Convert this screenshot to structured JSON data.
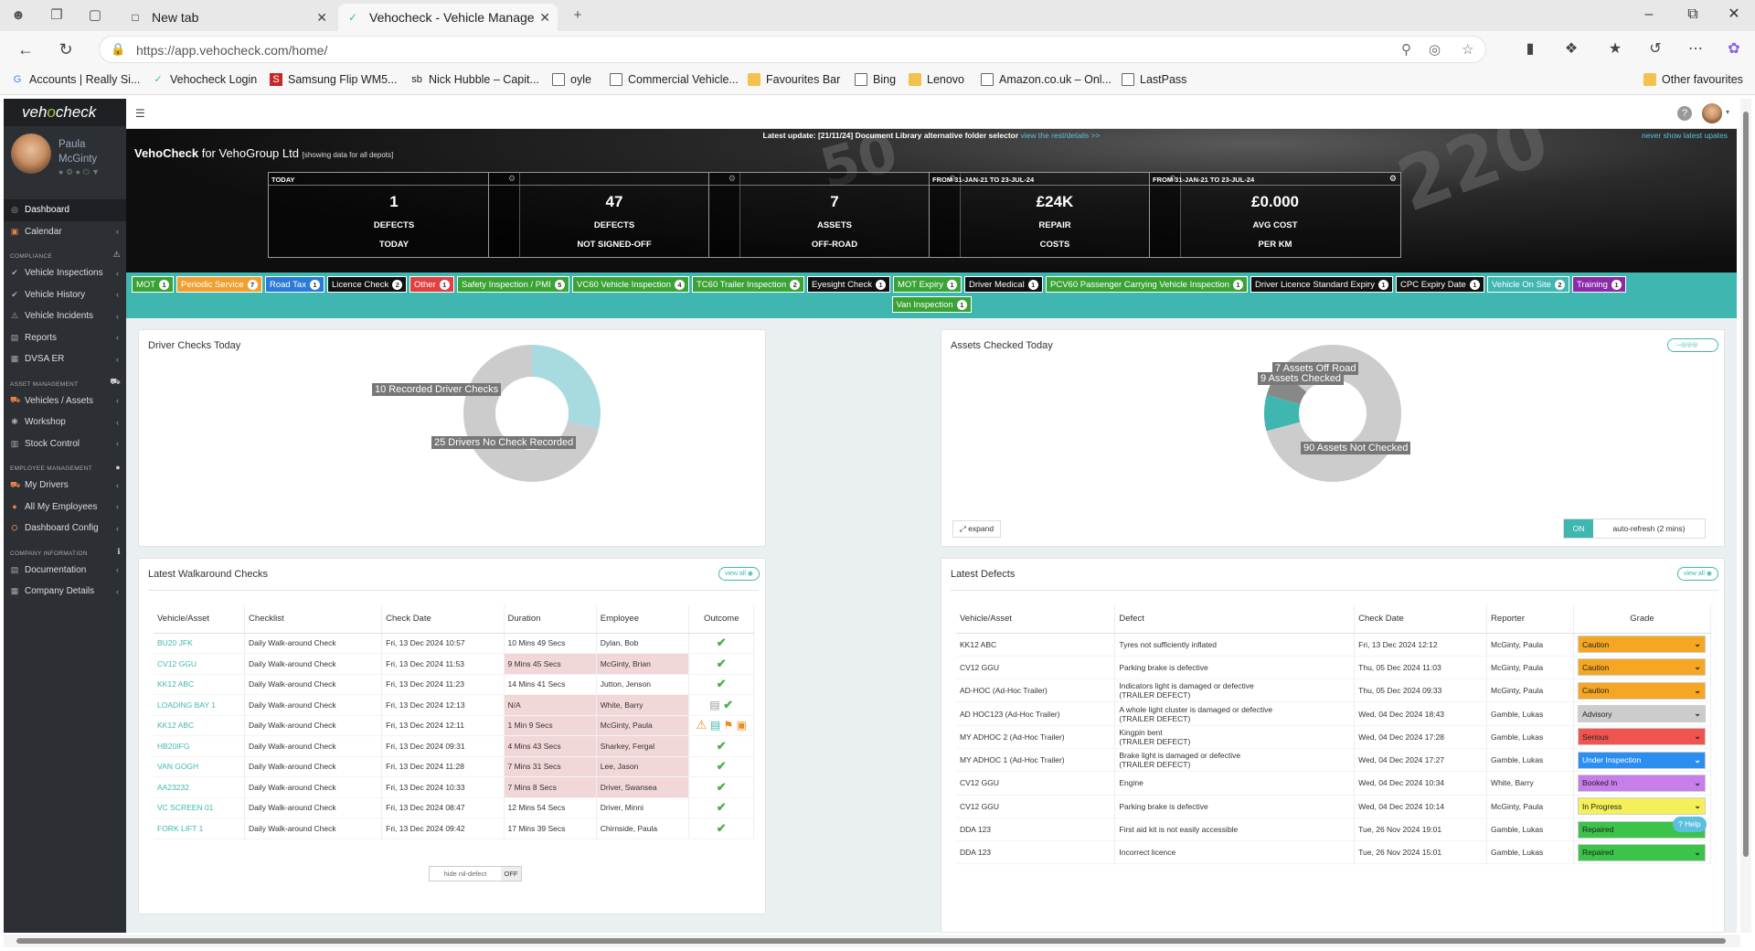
{
  "browser": {
    "tabs": [
      {
        "title": "New tab",
        "active": false
      },
      {
        "title": "Vehocheck - Vehicle Managemen",
        "active": true
      }
    ],
    "url": "https://app.vehocheck.com/home/",
    "bookmarks": [
      {
        "label": "Accounts | Really Si...",
        "icon": "google-icon"
      },
      {
        "label": "Vehocheck Login",
        "icon": "vehocheck-icon"
      },
      {
        "label": "Samsung Flip WM5...",
        "icon": "samsung-icon"
      },
      {
        "label": "Nick Hubble – Capit...",
        "icon": "sb-icon"
      },
      {
        "label": "oyle",
        "icon": "page-icon"
      },
      {
        "label": "Commercial Vehicle...",
        "icon": "page-icon"
      },
      {
        "label": "Favourites Bar",
        "icon": "folder-icon"
      },
      {
        "label": "Bing",
        "icon": "page-icon"
      },
      {
        "label": "Lenovo",
        "icon": "folder-icon"
      },
      {
        "label": "Amazon.co.uk – Onl...",
        "icon": "page-icon"
      },
      {
        "label": "LastPass",
        "icon": "page-icon"
      }
    ],
    "other_favourites": "Other favourites"
  },
  "sidebar": {
    "logo": "vehocheck",
    "user": {
      "first": "Paula",
      "last": "McGinty"
    },
    "items": [
      {
        "type": "item",
        "label": "Dashboard",
        "icon": "dashboard-icon",
        "active": true,
        "arrow": false
      },
      {
        "type": "item",
        "label": "Calendar",
        "icon": "calendar-icon",
        "arrow": true
      },
      {
        "type": "head",
        "label": "COMPLIANCE",
        "icon": "warning-icon"
      },
      {
        "type": "item",
        "label": "Vehicle Inspections",
        "icon": "check-icon",
        "arrow": true
      },
      {
        "type": "item",
        "label": "Vehicle History",
        "icon": "check-icon",
        "arrow": true
      },
      {
        "type": "item",
        "label": "Vehicle Incidents",
        "icon": "warning-icon",
        "arrow": true
      },
      {
        "type": "item",
        "label": "Reports",
        "icon": "report-icon",
        "arrow": true
      },
      {
        "type": "item",
        "label": "DVSA ER",
        "icon": "dvsa-icon",
        "arrow": true
      },
      {
        "type": "head",
        "label": "ASSET MANAGEMENT",
        "icon": "truck-icon"
      },
      {
        "type": "item",
        "label": "Vehicles / Assets",
        "icon": "truck-icon",
        "arrow": true
      },
      {
        "type": "item",
        "label": "Workshop",
        "icon": "wrench-icon",
        "arrow": true
      },
      {
        "type": "item",
        "label": "Stock Control",
        "icon": "box-icon",
        "arrow": true
      },
      {
        "type": "head",
        "label": "EMPLOYEE MANAGEMENT",
        "icon": "users-icon"
      },
      {
        "type": "item",
        "label": "My Drivers",
        "icon": "driver-icon",
        "arrow": true
      },
      {
        "type": "item",
        "label": "All My Employees",
        "icon": "users-icon",
        "arrow": true
      },
      {
        "type": "item",
        "label": "Dashboard Config",
        "icon": "config-icon",
        "arrow": true
      },
      {
        "type": "head",
        "label": "COMPANY INFORMATION",
        "icon": "info-icon"
      },
      {
        "type": "item",
        "label": "Documentation",
        "icon": "doc-icon",
        "arrow": true
      },
      {
        "type": "item",
        "label": "Company Details",
        "icon": "building-icon",
        "arrow": true
      }
    ]
  },
  "hero": {
    "update_label": "Latest update: [21/11/24] Document Library alternative folder selector",
    "update_link": "view the rest/details >>",
    "never_show": "never show latest upates",
    "company_prefix": "VehoCheck",
    "company_for": "for VehoGroup Ltd",
    "company_sub": "[showing data for all depots]",
    "stats": [
      {
        "header": "TODAY",
        "value": "1",
        "line1": "DEFECTS",
        "line2": "TODAY"
      },
      {
        "header": "",
        "value": "47",
        "line1": "DEFECTS",
        "line2": "NOT SIGNED-OFF"
      },
      {
        "header": "",
        "value": "7",
        "line1": "ASSETS",
        "line2": "OFF-ROAD"
      },
      {
        "header": "FROM 31-JAN-21 TO 23-JUL-24",
        "value": "£24K",
        "line1": "REPAIR",
        "line2": "COSTS"
      },
      {
        "header": "FROM 31-JAN-21 TO 23-JUL-24",
        "value": "£0.000",
        "line1": "AVG COST",
        "line2": "PER KM"
      }
    ]
  },
  "tags": [
    {
      "label": "MOT",
      "count": "1",
      "color": "#3aa335"
    },
    {
      "label": "Periodic Service",
      "count": "7",
      "color": "#f0a030"
    },
    {
      "label": "Road Tax",
      "count": "1",
      "color": "#2a7ad8"
    },
    {
      "label": "Licence Check",
      "count": "2",
      "color": "#111111"
    },
    {
      "label": "Other",
      "count": "1",
      "color": "#e04040"
    },
    {
      "label": "Safety Inspection / PMI",
      "count": "5",
      "color": "#3aa335"
    },
    {
      "label": "VC60 Vehicle Inspection",
      "count": "4",
      "color": "#3aa335"
    },
    {
      "label": "TC60 Trailer Inspection",
      "count": "2",
      "color": "#3aa335"
    },
    {
      "label": "Eyesight Check",
      "count": "1",
      "color": "#111111"
    },
    {
      "label": "MOT Expiry",
      "count": "1",
      "color": "#3aa335"
    },
    {
      "label": "Driver Medical",
      "count": "1",
      "color": "#111111"
    },
    {
      "label": "PCV60 Passenger Carrying Vehicle Inspection",
      "count": "1",
      "color": "#3aa335"
    },
    {
      "label": "Driver Licence Standard Expiry",
      "count": "1",
      "color": "#111111"
    },
    {
      "label": "CPC Expiry Date",
      "count": "1",
      "color": "#111111"
    },
    {
      "label": "Vehicle On Site",
      "count": "2",
      "color": "#3fb6b0"
    },
    {
      "label": "Training",
      "count": "1",
      "color": "#8a2aa8"
    },
    {
      "label": "Van Inspection",
      "count": "1",
      "color": "#3aa335"
    }
  ],
  "driver_checks": {
    "title_prefix": "Driver Checks",
    "title_bold": "Today",
    "chart_data": {
      "type": "pie",
      "slices": [
        {
          "label": "10 Recorded Driver Checks",
          "value": 10,
          "color": "#a8dbe0"
        },
        {
          "label": "25 Drivers No Check Recorded",
          "value": 25,
          "color": "#cccccc"
        }
      ]
    }
  },
  "assets_checked": {
    "title_prefix": "Assets Checked",
    "title_bold": "Today",
    "expand": "expand",
    "toggle_on": "ON",
    "auto_refresh": "auto-refresh (2 mins)",
    "chart_data": {
      "type": "pie",
      "slices": [
        {
          "label": "9 Assets Checked",
          "value": 9,
          "color": "#3fb6b0"
        },
        {
          "label": "7 Assets Off Road",
          "value": 7,
          "color": "#888888"
        },
        {
          "label": "90 Assets Not Checked",
          "value": 90,
          "color": "#cccccc"
        }
      ]
    }
  },
  "walkaround": {
    "title": "Latest Walkaround Checks",
    "view_all": "view all",
    "columns": [
      "Vehicle/Asset",
      "Checklist",
      "Check Date",
      "Duration",
      "Employee",
      "Outcome"
    ],
    "rows": [
      {
        "asset": "BU20 JFK",
        "checklist": "Daily Walk-around Check",
        "date": "Fri, 13 Dec 2024 10:57",
        "duration": "10 Mins 49 Secs",
        "employee": "Dylan, Bob",
        "outcome": "ok",
        "flag": false
      },
      {
        "asset": "CV12 GGU",
        "checklist": "Daily Walk-around Check",
        "date": "Fri, 13 Dec 2024 11:53",
        "duration": "9 Mins 45 Secs",
        "employee": "McGinty, Brian",
        "outcome": "ok",
        "flag": true
      },
      {
        "asset": "KK12 ABC",
        "checklist": "Daily Walk-around Check",
        "date": "Fri, 13 Dec 2024 11:23",
        "duration": "14 Mins 41 Secs",
        "employee": "Jutton, Jenson",
        "outcome": "ok",
        "flag": false
      },
      {
        "asset": "LOADING BAY 1",
        "checklist": "Daily Walk-around Check",
        "date": "Fri, 13 Dec 2024 12:13",
        "duration": "N/A",
        "employee": "White, Barry",
        "outcome": "doc",
        "flag": true
      },
      {
        "asset": "KK12 ABC",
        "checklist": "Daily Walk-around Check",
        "date": "Fri, 13 Dec 2024 12:11",
        "duration": "1 Min 9 Secs",
        "employee": "McGinty, Paula",
        "outcome": "defect",
        "flag": true
      },
      {
        "asset": "HB20IFG",
        "checklist": "Daily Walk-around Check",
        "date": "Fri, 13 Dec 2024 09:31",
        "duration": "4 Mins 43 Secs",
        "employee": "Sharkey, Fergal",
        "outcome": "ok",
        "flag": true
      },
      {
        "asset": "VAN GOGH",
        "checklist": "Daily Walk-around Check",
        "date": "Fri, 13 Dec 2024 11:28",
        "duration": "7 Mins 31 Secs",
        "employee": "Lee, Jason",
        "outcome": "ok",
        "flag": true
      },
      {
        "asset": "AA23232",
        "checklist": "Daily Walk-around Check",
        "date": "Fri, 13 Dec 2024 10:33",
        "duration": "7 Mins 8 Secs",
        "employee": "Driver, Swansea",
        "outcome": "ok",
        "flag": true
      },
      {
        "asset": "VC SCREEN 01",
        "checklist": "Daily Walk-around Check",
        "date": "Fri, 13 Dec 2024 08:47",
        "duration": "12 Mins 54 Secs",
        "employee": "Driver, Minni",
        "outcome": "ok",
        "flag": false
      },
      {
        "asset": "FORK LIFT 1",
        "checklist": "Daily Walk-around Check",
        "date": "Fri, 13 Dec 2024 09:42",
        "duration": "17 Mins 39 Secs",
        "employee": "Chirnside, Paula",
        "outcome": "ok",
        "flag": false
      }
    ],
    "hide_nil": "hide nil-defect",
    "toggle_off": "OFF"
  },
  "defects": {
    "title": "Latest Defects",
    "view_all": "view all",
    "columns": [
      "Vehicle/Asset",
      "Defect",
      "Check Date",
      "Reporter",
      "Grade"
    ],
    "rows": [
      {
        "asset": "KK12 ABC",
        "defect": "Tyres not sufficiently inflated",
        "sub": "",
        "date": "Fri, 13 Dec 2024 12:12",
        "reporter": "McGinty, Paula",
        "grade": "Caution",
        "grade_color": "#f5a623"
      },
      {
        "asset": "CV12 GGU",
        "defect": "Parking brake is defective",
        "sub": "",
        "date": "Thu, 05 Dec 2024 11:03",
        "reporter": "McGinty, Paula",
        "grade": "Caution",
        "grade_color": "#f5a623"
      },
      {
        "asset": "AD-HOC (Ad-Hoc Trailer)",
        "defect": "Indicators light is damaged or defective",
        "sub": "(TRAILER DEFECT)",
        "date": "Thu, 05 Dec 2024 09:33",
        "reporter": "McGinty, Paula",
        "grade": "Caution",
        "grade_color": "#f5a623"
      },
      {
        "asset": "AD HOC123 (Ad-Hoc Trailer)",
        "defect": "A whole light cluster is damaged or defective",
        "sub": "(TRAILER DEFECT)",
        "date": "Wed, 04 Dec 2024 18:43",
        "reporter": "Gamble, Lukas",
        "grade": "Advisory",
        "grade_color": "#cccccc"
      },
      {
        "asset": "MY ADHOC 2 (Ad-Hoc Trailer)",
        "defect": "Kingpin bent",
        "sub": "(TRAILER DEFECT)",
        "date": "Wed, 04 Dec 2024 17:28",
        "reporter": "Gamble, Lukas",
        "grade": "Serious",
        "grade_color": "#f0544f"
      },
      {
        "asset": "MY ADHOC 1 (Ad-Hoc Trailer)",
        "defect": "Brake light is damaged or defective",
        "sub": "(TRAILER DEFECT)",
        "date": "Wed, 04 Dec 2024 17:27",
        "reporter": "Gamble, Lukas",
        "grade": "Under Inspection",
        "grade_color": "#2b8ef0"
      },
      {
        "asset": "CV12 GGU",
        "defect": "Engine",
        "sub": "",
        "date": "Wed, 04 Dec 2024 10:34",
        "reporter": "White, Barry",
        "grade": "Booked In",
        "grade_color": "#c77dea"
      },
      {
        "asset": "CV12 GGU",
        "defect": "Parking brake is defective",
        "sub": "",
        "date": "Wed, 04 Dec 2024 10:14",
        "reporter": "McGinty, Paula",
        "grade": "In Progress",
        "grade_color": "#f5f05a"
      },
      {
        "asset": "DDA 123",
        "defect": "First aid kit is not easily accessible",
        "sub": "",
        "date": "Tue, 26 Nov 2024 19:01",
        "reporter": "Gamble, Lukas",
        "grade": "Repaired",
        "grade_color": "#3cc34a"
      },
      {
        "asset": "DDA 123",
        "defect": "Incorrect licence",
        "sub": "",
        "date": "Tue, 26 Nov 2024 15:01",
        "reporter": "Gamble, Lukas",
        "grade": "Repaired",
        "grade_color": "#3cc34a"
      }
    ],
    "help": "Help"
  }
}
